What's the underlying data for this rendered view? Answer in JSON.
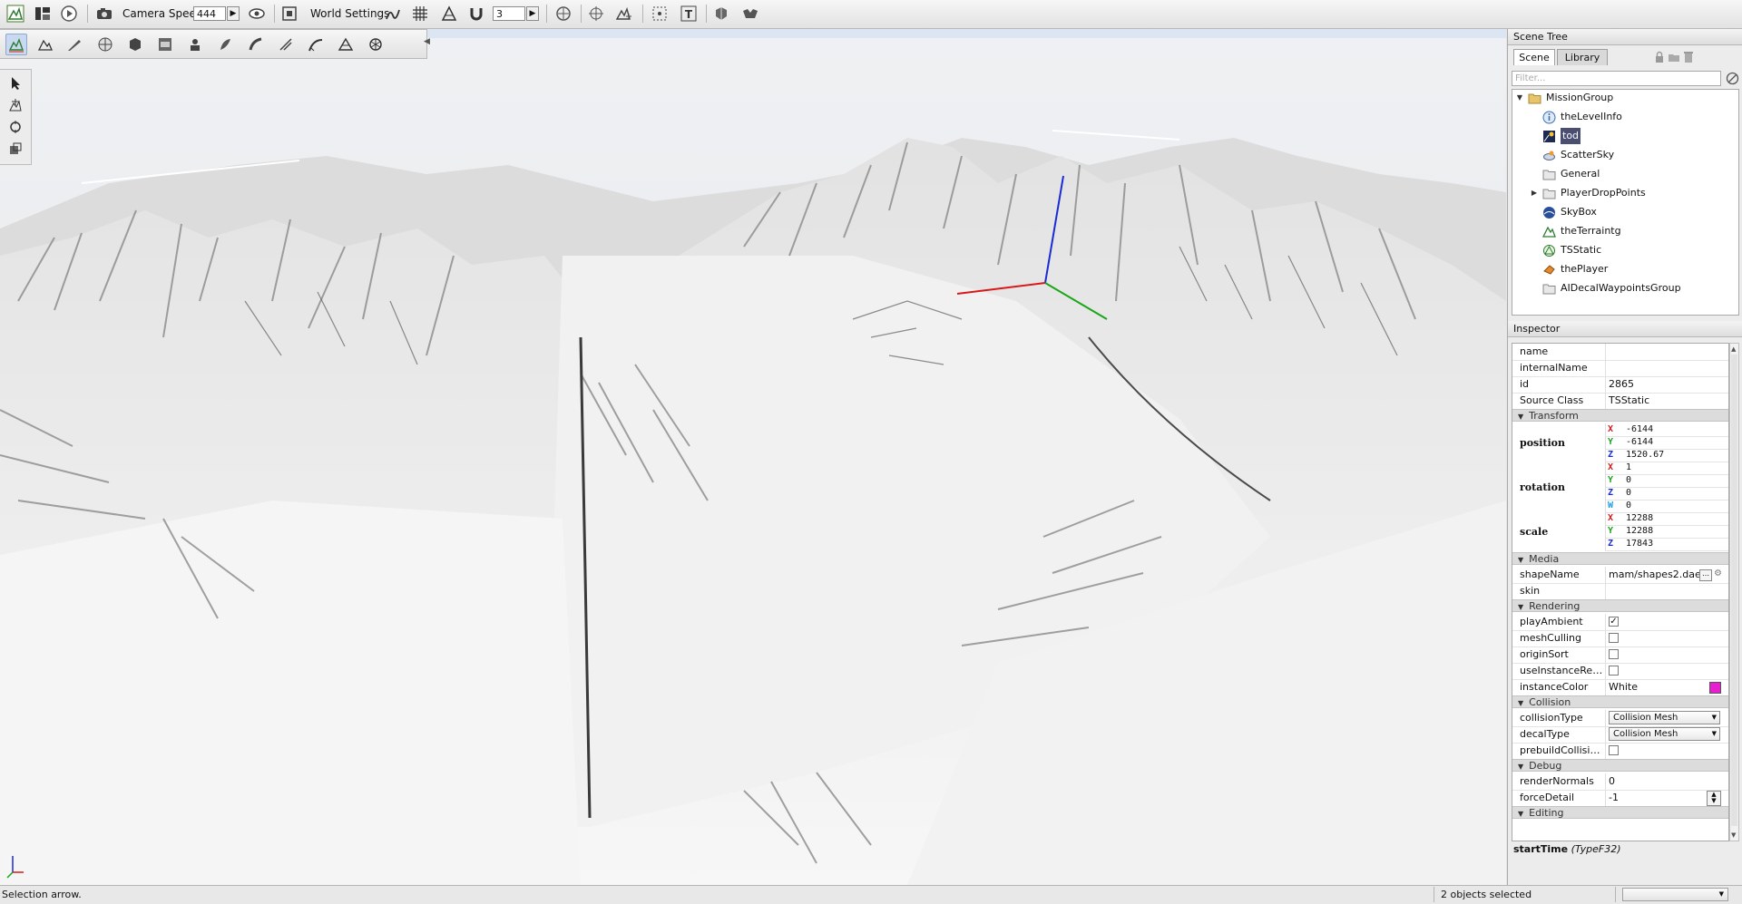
{
  "toolbar": {
    "camera_speed_label": "Camera Speed",
    "camera_speed_value": "444",
    "world_settings_label": "World Settings",
    "snap_value": "3"
  },
  "scene_tree": {
    "title": "Scene Tree",
    "tabs": [
      "Scene",
      "Library"
    ],
    "filter_placeholder": "Filter...",
    "items": [
      {
        "label": "MissionGroup",
        "icon": "folder-open-icon"
      },
      {
        "label": "theLevelInfo",
        "icon": "info-icon"
      },
      {
        "label": "tod",
        "icon": "time-of-day-icon"
      },
      {
        "label": "ScatterSky",
        "icon": "sky-icon"
      },
      {
        "label": "General",
        "icon": "folder-icon"
      },
      {
        "label": "PlayerDropPoints",
        "icon": "folder-icon"
      },
      {
        "label": "SkyBox",
        "icon": "skybox-icon"
      },
      {
        "label": "theTerraintg",
        "icon": "terrain-icon"
      },
      {
        "label": "TSStatic",
        "icon": "static-shape-icon"
      },
      {
        "label": "thePlayer",
        "icon": "player-icon"
      },
      {
        "label": "AIDecalWaypointsGroup",
        "icon": "folder-icon"
      }
    ]
  },
  "inspector": {
    "title": "Inspector",
    "fields": {
      "name": {
        "label": "name",
        "value": ""
      },
      "internalName": {
        "label": "internalName",
        "value": ""
      },
      "id": {
        "label": "id",
        "value": "2865"
      },
      "sourceClass": {
        "label": "Source Class",
        "value": "TSStatic"
      }
    },
    "categories": {
      "transform": "Transform",
      "media": "Media",
      "rendering": "Rendering",
      "collision": "Collision",
      "debug": "Debug",
      "editing": "Editing"
    },
    "position": {
      "label": "position",
      "x": "-6144",
      "y": "-6144",
      "z": "1520.67"
    },
    "rotation": {
      "label": "rotation",
      "x": "1",
      "y": "0",
      "z": "0",
      "w": "0"
    },
    "scale": {
      "label": "scale",
      "x": "12288",
      "y": "12288",
      "z": "17843"
    },
    "axes": {
      "x": "X",
      "y": "Y",
      "z": "Z",
      "w": "W"
    },
    "media": {
      "shapeName": {
        "label": "shapeName",
        "value": "mam/shapes2.dae"
      },
      "skin": {
        "label": "skin",
        "value": ""
      }
    },
    "rendering": {
      "playAmbient": {
        "label": "playAmbient",
        "checked": true
      },
      "meshCulling": {
        "label": "meshCulling",
        "checked": false
      },
      "originSort": {
        "label": "originSort",
        "checked": false
      },
      "useInstanceRender": {
        "label": "useInstanceRend...",
        "checked": false
      },
      "instanceColor": {
        "label": "instanceColor",
        "value": "White",
        "swatch": "#e81fd0"
      }
    },
    "collision": {
      "collisionType": {
        "label": "collisionType",
        "value": "Collision Mesh"
      },
      "decalType": {
        "label": "decalType",
        "value": "Collision Mesh"
      },
      "prebuildCollisionData": {
        "label": "prebuildCollisionD...",
        "checked": false
      }
    },
    "debug": {
      "renderNormals": {
        "label": "renderNormals",
        "value": "0"
      },
      "forceDetail": {
        "label": "forceDetail",
        "value": "-1"
      }
    },
    "help": {
      "field": "startTime",
      "type": "(TypeF32)"
    }
  },
  "status": {
    "left": "Selection arrow.",
    "selection": "2 objects selected"
  },
  "colors": {
    "selection_bg": "#4a4f72",
    "axis_x": "#d61a1a",
    "axis_y": "#1aa61a",
    "axis_z": "#1a2ad6"
  }
}
